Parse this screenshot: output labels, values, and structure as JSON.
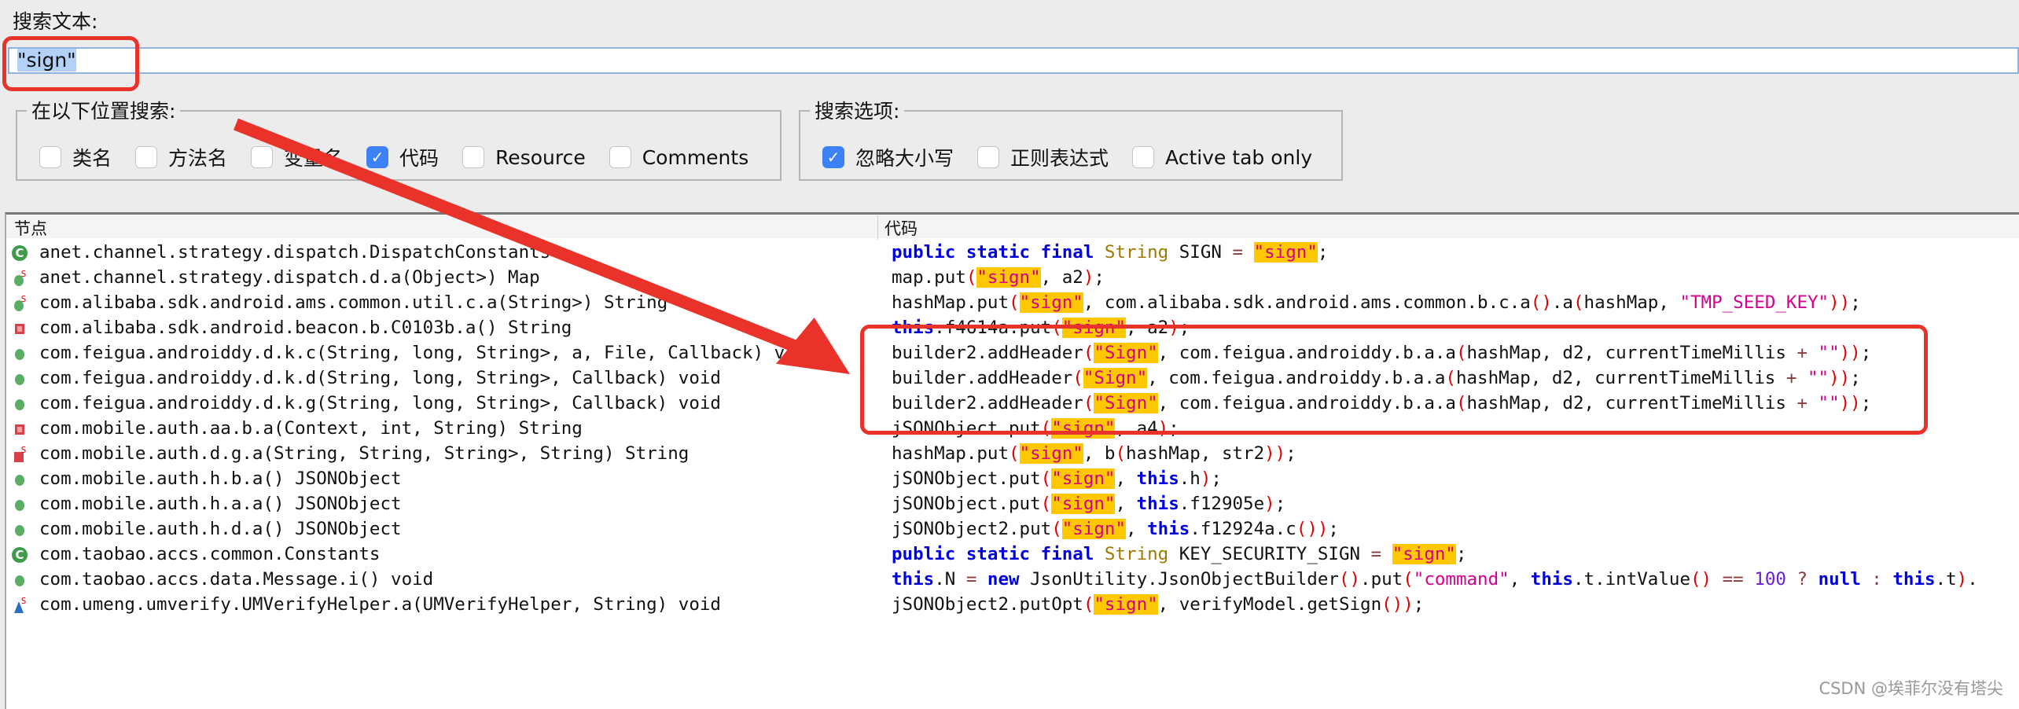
{
  "search": {
    "label": "搜索文本:",
    "value": "\"sign\""
  },
  "scope_group": {
    "title": "在以下位置搜索:",
    "options": [
      {
        "label": "类名",
        "checked": false
      },
      {
        "label": "方法名",
        "checked": false
      },
      {
        "label": "变量名",
        "checked": false
      },
      {
        "label": "代码",
        "checked": true
      },
      {
        "label": "Resource",
        "checked": false
      },
      {
        "label": "Comments",
        "checked": false
      }
    ]
  },
  "options_group": {
    "title": "搜索选项:",
    "options": [
      {
        "label": "忽略大小写",
        "checked": true
      },
      {
        "label": "正则表达式",
        "checked": false
      },
      {
        "label": "Active tab only",
        "checked": false
      }
    ]
  },
  "table": {
    "columns": [
      "节点",
      "代码"
    ],
    "rows": [
      {
        "icon": "class-icon",
        "node": "anet.channel.strategy.dispatch.DispatchConstants",
        "code": [
          [
            "kw",
            "public static final"
          ],
          [
            "type",
            " String"
          ],
          [
            "p",
            " SIGN "
          ],
          [
            "op",
            "="
          ],
          [
            "p",
            " "
          ],
          [
            "hl",
            "\"sign\""
          ],
          [
            "p",
            ";"
          ]
        ]
      },
      {
        "icon": "static-method-icon",
        "node": "anet.channel.strategy.dispatch.d.a(Object>) Map",
        "code": [
          [
            "p",
            "map.put"
          ],
          [
            "paren",
            "("
          ],
          [
            "hl",
            "\"sign\""
          ],
          [
            "p",
            ", a2"
          ],
          [
            "paren",
            ")"
          ],
          [
            "p",
            ";"
          ]
        ]
      },
      {
        "icon": "static-method-icon",
        "node": "com.alibaba.sdk.android.ams.common.util.c.a(String>) String",
        "code": [
          [
            "p",
            "hashMap.put"
          ],
          [
            "paren",
            "("
          ],
          [
            "hl",
            "\"sign\""
          ],
          [
            "p",
            ", com.alibaba.sdk.android.ams.common.b.c.a"
          ],
          [
            "paren",
            "()"
          ],
          [
            "p",
            ".a"
          ],
          [
            "paren",
            "("
          ],
          [
            "p",
            "hashMap, "
          ],
          [
            "str",
            "\"TMP_SEED_KEY\""
          ],
          [
            "paren",
            "))"
          ],
          [
            "p",
            ";"
          ]
        ]
      },
      {
        "icon": "private-method-icon",
        "node": "com.alibaba.sdk.android.beacon.b.C0103b.a() String",
        "code": [
          [
            "kw",
            "this"
          ],
          [
            "p",
            ".f4614a.put"
          ],
          [
            "paren",
            "("
          ],
          [
            "hl",
            "\"sign\""
          ],
          [
            "p",
            ", a2"
          ],
          [
            "paren",
            ")"
          ],
          [
            "p",
            ";"
          ]
        ]
      },
      {
        "icon": "method-icon",
        "node": "com.feigua.androiddy.d.k.c(String, long, String>, a, File, Callback) void",
        "code": [
          [
            "p",
            "builder2.addHeader"
          ],
          [
            "paren",
            "("
          ],
          [
            "hl",
            "\"Sign\""
          ],
          [
            "p",
            ", com.feigua.androiddy.b.a.a"
          ],
          [
            "paren",
            "("
          ],
          [
            "p",
            "hashMap, d2, currentTimeMillis "
          ],
          [
            "op",
            "+"
          ],
          [
            "p",
            " "
          ],
          [
            "str",
            "\"\""
          ],
          [
            "paren",
            "))"
          ],
          [
            "p",
            ";"
          ]
        ]
      },
      {
        "icon": "method-icon",
        "node": "com.feigua.androiddy.d.k.d(String, long, String>, Callback) void",
        "code": [
          [
            "p",
            "builder.addHeader"
          ],
          [
            "paren",
            "("
          ],
          [
            "hl",
            "\"Sign\""
          ],
          [
            "p",
            ", com.feigua.androiddy.b.a.a"
          ],
          [
            "paren",
            "("
          ],
          [
            "p",
            "hashMap, d2, currentTimeMillis "
          ],
          [
            "op",
            "+"
          ],
          [
            "p",
            " "
          ],
          [
            "str",
            "\"\""
          ],
          [
            "paren",
            "))"
          ],
          [
            "p",
            ";"
          ]
        ]
      },
      {
        "icon": "method-icon",
        "node": "com.feigua.androiddy.d.k.g(String, long, String>, Callback) void",
        "code": [
          [
            "p",
            "builder2.addHeader"
          ],
          [
            "paren",
            "("
          ],
          [
            "hl",
            "\"Sign\""
          ],
          [
            "p",
            ", com.feigua.androiddy.b.a.a"
          ],
          [
            "paren",
            "("
          ],
          [
            "p",
            "hashMap, d2, currentTimeMillis "
          ],
          [
            "op",
            "+"
          ],
          [
            "p",
            " "
          ],
          [
            "str",
            "\"\""
          ],
          [
            "paren",
            "))"
          ],
          [
            "p",
            ";"
          ]
        ]
      },
      {
        "icon": "private-method-icon",
        "node": "com.mobile.auth.aa.b.a(Context, int, String) String",
        "code": [
          [
            "p",
            "jSONObject.put"
          ],
          [
            "paren",
            "("
          ],
          [
            "hl",
            "\"sign\""
          ],
          [
            "p",
            ", a4"
          ],
          [
            "paren",
            ")"
          ],
          [
            "p",
            ";"
          ]
        ]
      },
      {
        "icon": "private-static-method-icon",
        "node": "com.mobile.auth.d.g.a(String, String, String>, String) String",
        "code": [
          [
            "p",
            "hashMap.put"
          ],
          [
            "paren",
            "("
          ],
          [
            "hl",
            "\"sign\""
          ],
          [
            "p",
            ", b"
          ],
          [
            "paren",
            "("
          ],
          [
            "p",
            "hashMap, str2"
          ],
          [
            "paren",
            "))"
          ],
          [
            "p",
            ";"
          ]
        ]
      },
      {
        "icon": "method-icon",
        "node": "com.mobile.auth.h.b.a() JSONObject",
        "code": [
          [
            "p",
            "jSONObject.put"
          ],
          [
            "paren",
            "("
          ],
          [
            "hl",
            "\"sign\""
          ],
          [
            "p",
            ", "
          ],
          [
            "kw",
            "this"
          ],
          [
            "p",
            ".h"
          ],
          [
            "paren",
            ")"
          ],
          [
            "p",
            ";"
          ]
        ]
      },
      {
        "icon": "method-icon",
        "node": "com.mobile.auth.h.a.a() JSONObject",
        "code": [
          [
            "p",
            "jSONObject.put"
          ],
          [
            "paren",
            "("
          ],
          [
            "hl",
            "\"sign\""
          ],
          [
            "p",
            ", "
          ],
          [
            "kw",
            "this"
          ],
          [
            "p",
            ".f12905e"
          ],
          [
            "paren",
            ")"
          ],
          [
            "p",
            ";"
          ]
        ]
      },
      {
        "icon": "method-icon",
        "node": "com.mobile.auth.h.d.a() JSONObject",
        "code": [
          [
            "p",
            "jSONObject2.put"
          ],
          [
            "paren",
            "("
          ],
          [
            "hl",
            "\"sign\""
          ],
          [
            "p",
            ", "
          ],
          [
            "kw",
            "this"
          ],
          [
            "p",
            ".f12924a.c"
          ],
          [
            "paren",
            "())"
          ],
          [
            "p",
            ";"
          ]
        ]
      },
      {
        "icon": "class-icon",
        "node": "com.taobao.accs.common.Constants",
        "code": [
          [
            "kw",
            "public static final"
          ],
          [
            "type",
            " String"
          ],
          [
            "p",
            " KEY_SECURITY_SIGN "
          ],
          [
            "op",
            "="
          ],
          [
            "p",
            " "
          ],
          [
            "hl",
            "\"sign\""
          ],
          [
            "p",
            ";"
          ]
        ]
      },
      {
        "icon": "method-icon",
        "node": "com.taobao.accs.data.Message.i() void",
        "code": [
          [
            "kw",
            "this"
          ],
          [
            "p",
            ".N "
          ],
          [
            "op",
            "="
          ],
          [
            "p",
            " "
          ],
          [
            "kw",
            "new"
          ],
          [
            "p",
            " JsonUtility.JsonObjectBuilder"
          ],
          [
            "paren",
            "()"
          ],
          [
            "p",
            ".put"
          ],
          [
            "paren",
            "("
          ],
          [
            "str",
            "\"command\""
          ],
          [
            "p",
            ", "
          ],
          [
            "kw",
            "this"
          ],
          [
            "p",
            ".t.intValue"
          ],
          [
            "paren",
            "()"
          ],
          [
            "p",
            " "
          ],
          [
            "op",
            "=="
          ],
          [
            "p",
            " "
          ],
          [
            "num",
            "100"
          ],
          [
            "p",
            " "
          ],
          [
            "op",
            "?"
          ],
          [
            "p",
            " "
          ],
          [
            "kw",
            "null"
          ],
          [
            "p",
            " "
          ],
          [
            "op",
            ":"
          ],
          [
            "p",
            " "
          ],
          [
            "kw",
            "this"
          ],
          [
            "p",
            ".t"
          ],
          [
            "paren",
            ")"
          ],
          [
            "p",
            "."
          ]
        ]
      },
      {
        "icon": "static-field-icon",
        "node": "com.umeng.umverify.UMVerifyHelper.a(UMVerifyHelper, String) void",
        "code": [
          [
            "p",
            "jSONObject2.putOpt"
          ],
          [
            "paren",
            "("
          ],
          [
            "hl",
            "\"sign\""
          ],
          [
            "p",
            ", verifyModel.getSign"
          ],
          [
            "paren",
            "())"
          ],
          [
            "p",
            ";"
          ]
        ]
      }
    ]
  },
  "annotation_color": "#e8322a",
  "watermark": "CSDN @埃菲尔没有塔尖"
}
